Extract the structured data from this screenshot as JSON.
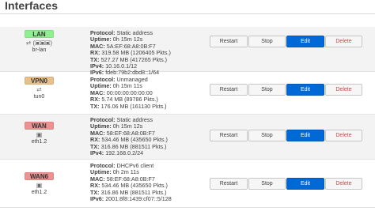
{
  "page_title": "Interfaces",
  "buttons": {
    "restart": "Restart",
    "stop": "Stop",
    "edit": "Edit",
    "delete": "Delete"
  },
  "interfaces": [
    {
      "name": "LAN",
      "badge_color": "#90f090",
      "icon": "bridge-devices-icon",
      "icon_text": "⮂ (▣▣▣)",
      "device": "br-lan",
      "lines": [
        {
          "label": "Protocol:",
          "value": "Static address"
        },
        {
          "label": "Uptime:",
          "value": "0h 15m 12s"
        },
        {
          "label": "MAC:",
          "value": "5A:EF:68:A8:0B:F7"
        },
        {
          "label": "RX:",
          "value": "319.58 MB (1206405 Pkts.)"
        },
        {
          "label": "TX:",
          "value": "527.27 MB (417265 Pkts.)"
        },
        {
          "label": "IPv4:",
          "value": "10.16.0.1/12"
        },
        {
          "label": "IPv6:",
          "value": "fdeb:79b2:dbd8::1/64"
        }
      ]
    },
    {
      "name": "VPN0",
      "badge_color": "#e8c088",
      "icon": "tunnel-icon",
      "icon_text": "⮂",
      "device": "tun0",
      "lines": [
        {
          "label": "Protocol:",
          "value": "Unmanaged"
        },
        {
          "label": "Uptime:",
          "value": "0h 15m 11s"
        },
        {
          "label": "MAC:",
          "value": "00:00:00:00:00:00"
        },
        {
          "label": "RX:",
          "value": "5.74 MB (89786 Pkts.)"
        },
        {
          "label": "TX:",
          "value": "176.06 MB (161130 Pkts.)"
        }
      ]
    },
    {
      "name": "WAN",
      "badge_color": "#f09090",
      "icon": "ethernet-port-icon",
      "icon_text": "▣",
      "device": "eth1.2",
      "lines": [
        {
          "label": "Protocol:",
          "value": "Static address"
        },
        {
          "label": "Uptime:",
          "value": "0h 15m 12s"
        },
        {
          "label": "MAC:",
          "value": "58:EF:68:A8:0B:F7"
        },
        {
          "label": "RX:",
          "value": "534.46 MB (435650 Pkts.)"
        },
        {
          "label": "TX:",
          "value": "316.86 MB (881511 Pkts.)"
        },
        {
          "label": "IPv4:",
          "value": "192.168.0.2/24"
        }
      ]
    },
    {
      "name": "WAN6",
      "badge_color": "#f09090",
      "icon": "ethernet-port-icon",
      "icon_text": "▣",
      "device": "eth1.2",
      "lines": [
        {
          "label": "Protocol:",
          "value": "DHCPv6 client"
        },
        {
          "label": "Uptime:",
          "value": "0h 2m 11s"
        },
        {
          "label": "MAC:",
          "value": "58:EF:68:A8:0B:F7"
        },
        {
          "label": "RX:",
          "value": "534.46 MB (435650 Pkts.)"
        },
        {
          "label": "TX:",
          "value": "316.86 MB (881511 Pkts.)"
        },
        {
          "label": "IPv6:",
          "value": "2001:8f8:1439:cf07::5/128"
        }
      ]
    }
  ]
}
